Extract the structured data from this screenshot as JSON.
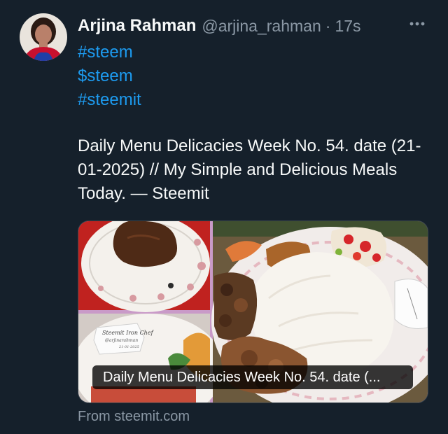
{
  "author": {
    "name": "Arjina Rahman",
    "handle": "@arjina_rahman",
    "separator": "·",
    "time": "17s"
  },
  "tweet": {
    "hashtags": [
      "#steem",
      "$steem",
      "#steemit"
    ],
    "text": "Daily Menu Delicacies Week No. 54. date (21-01-2025) // My Simple and Delicious Meals Today. — Steemit"
  },
  "link_card": {
    "title": "Daily Menu Delicacies Week No. 54. date (...",
    "source": "From steemit.com",
    "image_sign_text": "Steemit Iron Chef",
    "image_sign_handle": "@arjinarahman",
    "image_sign_date": "21-01-2025"
  },
  "icons": {
    "more": "more-horizontal-icon"
  },
  "colors": {
    "background": "#15202b",
    "text_primary": "#f7f9f9",
    "text_secondary": "#8b98a5",
    "link": "#1d9bf0"
  }
}
